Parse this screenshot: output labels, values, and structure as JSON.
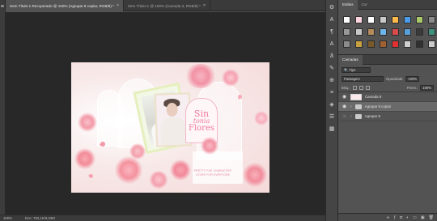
{
  "tabs": [
    {
      "label": "Sem Título-1 Recuperado @ 100% (Agrupar 8 copiar, RGB/8) *",
      "active": true,
      "close_icon": "×"
    },
    {
      "label": "Sem Título-1 @ 100% (Camada 3, RGB/8) *",
      "active": false,
      "close_icon": "×"
    }
  ],
  "artwork": {
    "title_line1": "Sin",
    "title_line2": "tonia",
    "title_line3": "Flores",
    "caption": "PRETTY FAE CHARACTER LOVER FOR EVERYONE"
  },
  "status": {
    "zoom": "100%",
    "doc": "Doc: 783,1K/9,33M"
  },
  "panels": {
    "tab_swatches": "Estilos",
    "tab_color": "Cor",
    "swatches": [
      "#ffffff",
      "#ffd6e0",
      "#ffffff",
      "#c9c9c9",
      "#ffb84a",
      "#4a9be8",
      "#a8c86a",
      "#8a8a8a",
      "#999999",
      "#c8c8c8",
      "#b38b5c",
      "#6fb6e8",
      "#d94a4a",
      "#5aa0d8",
      "#3a3a3a",
      "#3f8f7a",
      "#8c8c8c",
      "#c8a040",
      "#7a5a2a",
      "#a06030",
      "#e03030",
      "#d0d0d0",
      "#303030",
      "#cccccc"
    ],
    "layers_tab": "Camadas",
    "filter_label": "Tipo",
    "blend_mode": "Passagem",
    "opacity_label": "Opacidade:",
    "opacity_value": "100%",
    "lock_label": "Bloq.:",
    "fill_label": "Preen.:",
    "fill_value": "100%",
    "layers": [
      {
        "name": "Camada 8",
        "kind": "layer",
        "selected": false
      },
      {
        "name": "Agrupar 8 copiar",
        "kind": "group",
        "selected": true
      },
      {
        "name": "Agrupar 8",
        "kind": "group",
        "selected": false
      }
    ]
  }
}
